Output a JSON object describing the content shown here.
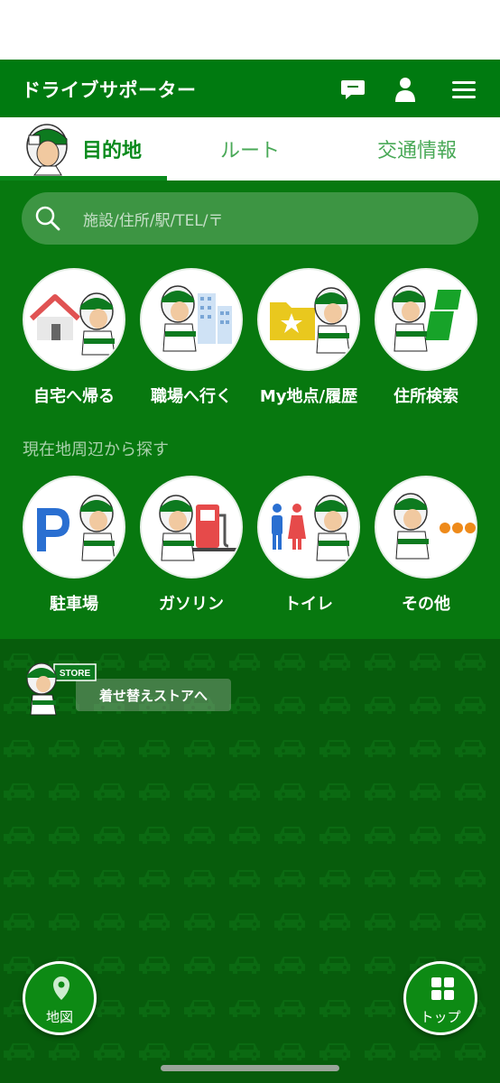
{
  "app": {
    "title": "ドライブサポーター"
  },
  "header_icons": [
    "message-icon",
    "user-icon",
    "menu-icon"
  ],
  "tabs": [
    {
      "label": "目的地",
      "active": true
    },
    {
      "label": "ルート",
      "active": false
    },
    {
      "label": "交通情報",
      "active": false
    }
  ],
  "search": {
    "placeholder": "施設/住所/駅/TEL/〒"
  },
  "quick": [
    {
      "label": "自宅へ帰る",
      "icon": "home-icon"
    },
    {
      "label": "職場へ行く",
      "icon": "office-icon"
    },
    {
      "label": "My地点/履歴",
      "icon": "folder-star-icon"
    },
    {
      "label": "住所検索",
      "icon": "address-icon"
    }
  ],
  "nearby": {
    "title": "現在地周辺から探す",
    "items": [
      {
        "label": "駐車場",
        "icon": "parking-icon"
      },
      {
        "label": "ガソリン",
        "icon": "gas-station-icon"
      },
      {
        "label": "トイレ",
        "icon": "toilet-icon"
      },
      {
        "label": "その他",
        "icon": "more-icon"
      }
    ]
  },
  "store": {
    "label": "着せ替えストアへ",
    "sign": "STORE"
  },
  "fab": {
    "map_label": "地図",
    "top_label": "トップ"
  },
  "colors": {
    "brand_green": "#007a10",
    "panel_green": "#07780f",
    "bg_green": "#075c0c"
  }
}
